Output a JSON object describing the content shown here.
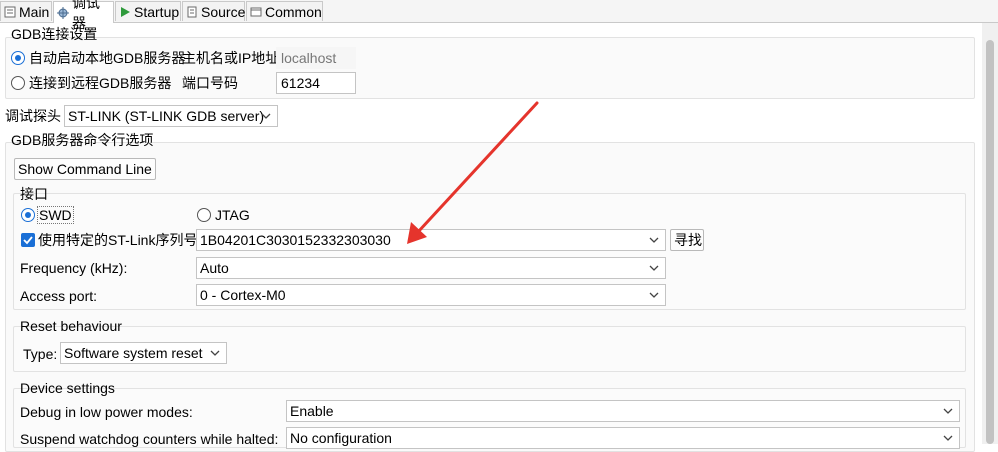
{
  "tabs": [
    {
      "label": "Main",
      "icon": "main-tab-icon"
    },
    {
      "label": "调试器",
      "icon": "debugger-tab-icon"
    },
    {
      "label": "Startup",
      "icon": "startup-tab-icon"
    },
    {
      "label": "Source",
      "icon": "source-tab-icon"
    },
    {
      "label": "Common",
      "icon": "common-tab-icon"
    }
  ],
  "gdb_connection": {
    "title": "GDB连接设置",
    "auto_start_label": "自动启动本地GDB服务器",
    "connect_remote_label": "连接到远程GDB服务器",
    "host_label": "主机名或IP地址",
    "host_value": "localhost",
    "port_label": "端口号码",
    "port_value": "61234"
  },
  "probe": {
    "label": "调试探头",
    "value": "ST-LINK (ST-LINK GDB server)"
  },
  "server_options": {
    "title": "GDB服务器命令行选项",
    "show_command_line": "Show Command Line",
    "interface": {
      "title": "接口",
      "swd_label": "SWD",
      "jtag_label": "JTAG"
    },
    "use_serial_label": "使用特定的ST-Link序列号",
    "serial_value": "1B04201C3030152332303030",
    "find_button": "寻找",
    "frequency_label": "Frequency (kHz):",
    "frequency_value": "Auto",
    "access_port_label": "Access port:",
    "access_port_value": "0 - Cortex-M0"
  },
  "reset": {
    "title": "Reset behaviour",
    "type_label": "Type:",
    "type_value": "Software system reset"
  },
  "device": {
    "title": "Device settings",
    "low_power_label": "Debug in low power modes:",
    "low_power_value": "Enable",
    "watchdog_label": "Suspend watchdog counters while halted:",
    "watchdog_value": "No configuration"
  },
  "colors": {
    "accent": "#1a6fd6",
    "annotation_arrow": "#e5342c"
  }
}
